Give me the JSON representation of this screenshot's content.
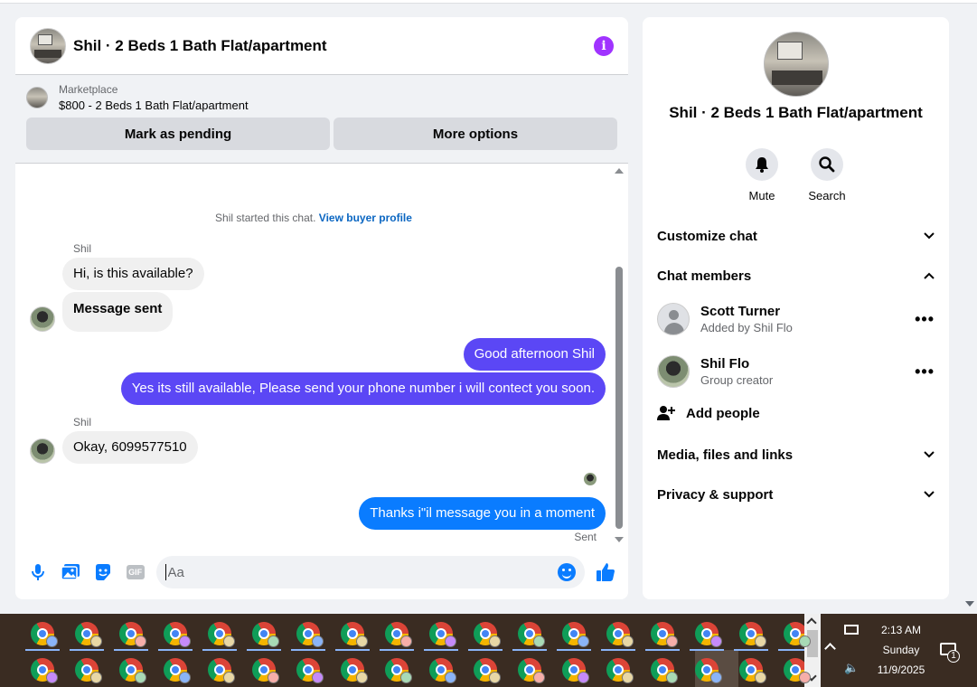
{
  "header": {
    "title": "Shil · 2 Beds 1 Bath Flat/apartment",
    "info_icon": "i"
  },
  "listing": {
    "kind": "Marketplace",
    "price_title": "$800 - 2 Beds 1 Bath Flat/apartment",
    "pending_label": "Mark as pending",
    "more_label": "More options"
  },
  "conversation": {
    "started_prefix": "Shil started this chat.",
    "buyer_profile_link": "View buyer profile",
    "sender_name_1": "Shil",
    "msg_1": "Hi, is this available?",
    "msg_2": "Message sent",
    "msg_3": "Good afternoon Shil",
    "msg_4": "Yes its still available, Please send your phone number i will contect you soon.",
    "sender_name_2": "Shil",
    "msg_5": "Okay, 6099577510",
    "msg_6": "Thanks i\"il message you in a moment",
    "status": "Sent"
  },
  "composer": {
    "placeholder": "Aa",
    "gif_label": "GIF"
  },
  "info_panel": {
    "title": "Shil · 2 Beds 1 Bath Flat/apartment",
    "mute_label": "Mute",
    "search_label": "Search",
    "customize_chat": "Customize chat",
    "chat_members": "Chat members",
    "members": [
      {
        "name": "Scott Turner",
        "sub": "Added by Shil Flo"
      },
      {
        "name": "Shil Flo",
        "sub": "Group creator"
      }
    ],
    "add_people": "Add people",
    "media_files_links": "Media, files and links",
    "privacy_support": "Privacy & support"
  },
  "taskbar": {
    "time": "2:13 AM",
    "day": "Sunday",
    "date": "11/9/2025",
    "notification_count": "1"
  },
  "colors": {
    "outgoing_bubble": "#5b47f5",
    "latest_outgoing_bubble": "#0a7cff",
    "info_icon": "#a033ff",
    "link": "#0a66c2"
  }
}
